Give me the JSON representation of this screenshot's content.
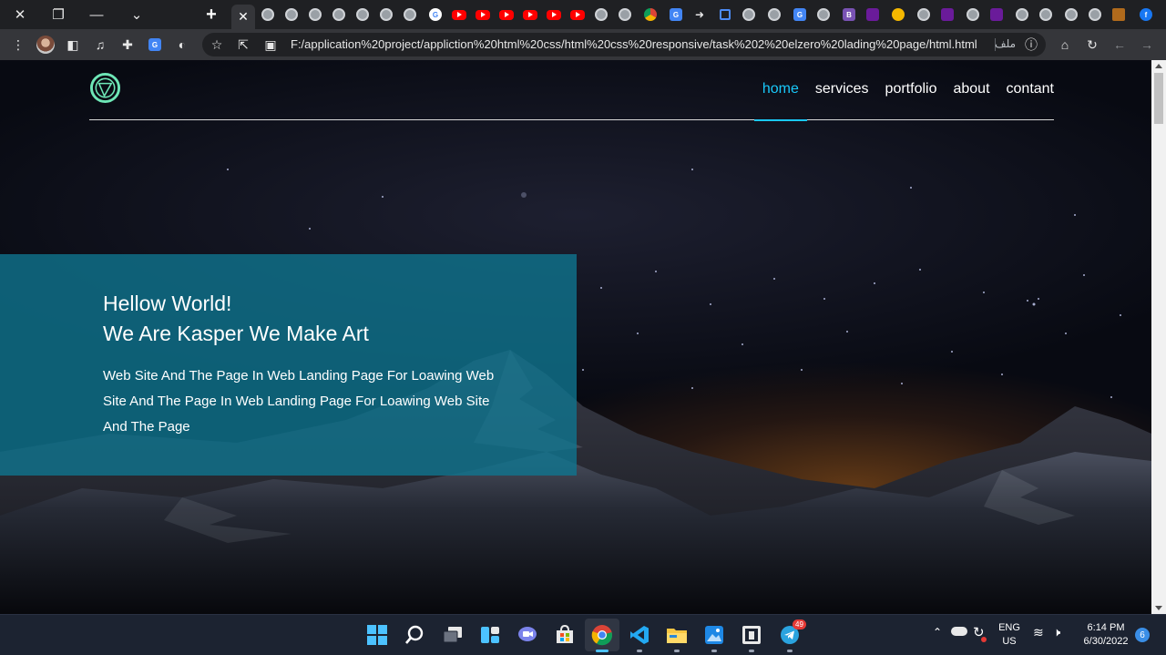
{
  "browser": {
    "url": "F:/application%20project/appliction%20html%20css/html%20css%20responsive/task%202%20elzero%20lading%20page/html.html",
    "file_label": "ملف"
  },
  "site": {
    "nav": [
      "home",
      "services",
      "portfolio",
      "about",
      "contant"
    ],
    "nav_active_index": 0,
    "hero": {
      "title_line1": "Hellow World!",
      "title_line2": "We Are Kasper We Make Art",
      "body": "Web Site And The Page In Web Landing Page For Loawing Web Site And The Page In Web Landing Page For Loawing Web Site And The Page"
    },
    "colors": {
      "accent": "#19c8fa",
      "hero_box": "#0f748f",
      "logo": "#6ee7b7"
    }
  },
  "taskbar": {
    "lang": "ENG",
    "region": "US",
    "time": "6:14 PM",
    "date": "6/30/2022",
    "notifications": "6",
    "telegram_badge": "49"
  }
}
